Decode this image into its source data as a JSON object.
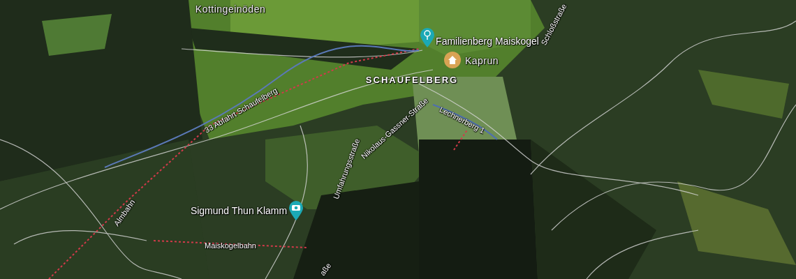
{
  "map": {
    "labels": [
      {
        "text": "Kottingeinöden",
        "kind": "locality"
      },
      {
        "text": "SCHAUFELBERG",
        "kind": "district"
      },
      {
        "text": "Familienberg Maiskogel",
        "kind": "poi"
      },
      {
        "text": "Kaprun",
        "kind": "locality"
      },
      {
        "text": "33 Abfahrt Schaufelberg",
        "kind": "road"
      },
      {
        "text": "Nikolaus-Gassner-Straße",
        "kind": "road"
      },
      {
        "text": "Lechnerberg 1",
        "kind": "road"
      },
      {
        "text": "Umfahrungsstraße",
        "kind": "road"
      },
      {
        "text": "Almbahn",
        "kind": "road"
      },
      {
        "text": "Sigmund Thun Klamm",
        "kind": "poi"
      },
      {
        "text": "Maiskogelbahn",
        "kind": "road"
      },
      {
        "text": "Schloßstraße",
        "kind": "road"
      },
      {
        "text": "aße",
        "kind": "road"
      }
    ],
    "pins": [
      {
        "kind": "tree",
        "color": "#1ba9b5"
      },
      {
        "kind": "home",
        "color": "#d9a354"
      },
      {
        "kind": "camera",
        "color": "#1ba9b5"
      }
    ]
  }
}
